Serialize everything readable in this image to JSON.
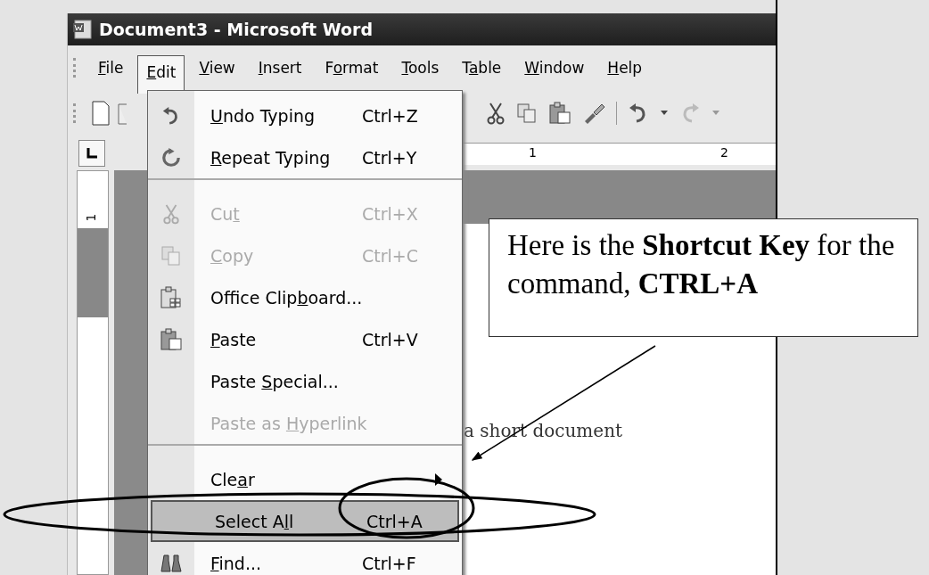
{
  "window": {
    "title": "Document3 - Microsoft Word"
  },
  "menu_bar": [
    {
      "key": "F",
      "post": "ile",
      "selected": false
    },
    {
      "key": "E",
      "post": "dit",
      "selected": true
    },
    {
      "key": "V",
      "post": "iew",
      "selected": false
    },
    {
      "key": "I",
      "post": "nsert",
      "selected": false
    },
    {
      "pre": "F",
      "key": "o",
      "post": "rmat",
      "selected": false
    },
    {
      "key": "T",
      "post": "ools",
      "selected": false
    },
    {
      "pre": "T",
      "key": "a",
      "post": "ble",
      "selected": false
    },
    {
      "key": "W",
      "post": "indow",
      "selected": false
    },
    {
      "key": "H",
      "post": "elp",
      "selected": false
    }
  ],
  "ruler": {
    "marks": [
      "1",
      "2"
    ],
    "vertical_mark": "1"
  },
  "edit_menu": [
    {
      "kind": "undo",
      "key": "U",
      "post": "ndo Typing",
      "shortcut": "Ctrl+Z",
      "disabled": false,
      "selected": false,
      "separator_after": false,
      "submenu": false
    },
    {
      "kind": "redo",
      "key": "R",
      "post": "epeat Typing",
      "shortcut": "Ctrl+Y",
      "disabled": false,
      "selected": false,
      "separator_after": true,
      "submenu": false
    },
    {
      "kind": "cut",
      "pre": "Cu",
      "key": "t",
      "shortcut": "Ctrl+X",
      "disabled": true,
      "selected": false,
      "separator_after": false,
      "submenu": false
    },
    {
      "kind": "copy",
      "key": "C",
      "post": "opy",
      "shortcut": "Ctrl+C",
      "disabled": true,
      "selected": false,
      "separator_after": false,
      "submenu": false
    },
    {
      "kind": "clipboard",
      "pre": "Office Clip",
      "key": "b",
      "post": "oard...",
      "disabled": false,
      "selected": false,
      "separator_after": false,
      "submenu": false
    },
    {
      "kind": "paste",
      "key": "P",
      "post": "aste",
      "shortcut": "Ctrl+V",
      "disabled": false,
      "selected": false,
      "separator_after": false,
      "submenu": false
    },
    {
      "kind": "plain",
      "pre": "Paste ",
      "key": "S",
      "post": "pecial...",
      "disabled": false,
      "selected": false,
      "separator_after": false,
      "submenu": false
    },
    {
      "kind": "plain",
      "pre": "Paste as ",
      "key": "H",
      "post": "yperlink",
      "disabled": true,
      "selected": false,
      "separator_after": true,
      "submenu": false
    },
    {
      "kind": "plain",
      "pre": "Cle",
      "key": "a",
      "post": "r",
      "disabled": false,
      "selected": false,
      "separator_after": false,
      "submenu": true
    },
    {
      "kind": "plain",
      "pre": "Select A",
      "key": "l",
      "post": "l",
      "shortcut": "Ctrl+A",
      "disabled": false,
      "selected": true,
      "separator_after": false,
      "submenu": false
    },
    {
      "kind": "find",
      "key": "F",
      "post": "ind...",
      "shortcut": "Ctrl+F",
      "disabled": false,
      "selected": false,
      "separator_after": false,
      "submenu": false
    }
  ],
  "document": {
    "text": "a short document"
  },
  "callout": {
    "text": "Here is the **Shortcut Key** for the command, **CTRL+A**"
  }
}
